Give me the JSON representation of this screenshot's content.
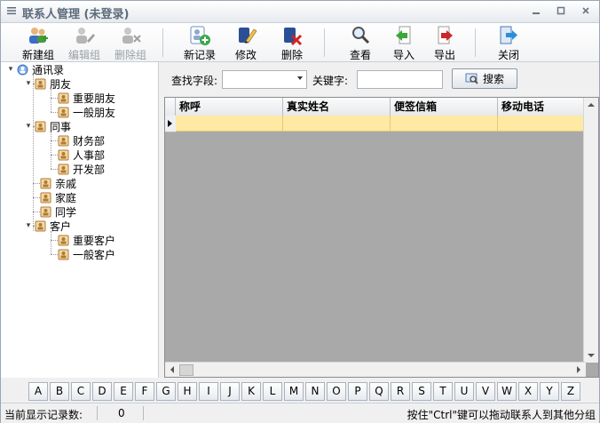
{
  "window": {
    "title": "联系人管理 (未登录)",
    "controls": [
      "minimize",
      "restore",
      "close"
    ]
  },
  "toolbar": {
    "buttons": [
      {
        "label": "新建组",
        "icon": "users-add-icon",
        "enabled": true
      },
      {
        "label": "编辑组",
        "icon": "users-edit-icon",
        "enabled": false
      },
      {
        "label": "删除组",
        "icon": "users-delete-icon",
        "enabled": false
      },
      {
        "label": "新记录",
        "icon": "contact-add-icon",
        "enabled": true
      },
      {
        "label": "修改",
        "icon": "pencil-icon",
        "enabled": true
      },
      {
        "label": "删除",
        "icon": "delete-icon",
        "enabled": true
      },
      {
        "label": "查看",
        "icon": "magnifier-icon",
        "enabled": true
      },
      {
        "label": "导入",
        "icon": "import-icon",
        "enabled": true
      },
      {
        "label": "导出",
        "icon": "export-icon",
        "enabled": true
      },
      {
        "label": "关闭",
        "icon": "exit-icon",
        "enabled": true
      }
    ]
  },
  "tree": {
    "root": "通讯录",
    "groups": [
      {
        "label": "朋友",
        "expanded": true,
        "children": [
          "重要朋友",
          "一般朋友"
        ]
      },
      {
        "label": "同事",
        "expanded": true,
        "children": [
          "财务部",
          "人事部",
          "开发部"
        ]
      },
      {
        "label": "亲戚",
        "expanded": false,
        "children": []
      },
      {
        "label": "家庭",
        "expanded": false,
        "children": []
      },
      {
        "label": "同学",
        "expanded": false,
        "children": []
      },
      {
        "label": "客户",
        "expanded": true,
        "children": [
          "重要客户",
          "一般客户"
        ]
      }
    ]
  },
  "search": {
    "field_label": "查找字段:",
    "field_value": "",
    "keyword_label": "关键字:",
    "keyword_value": "",
    "button_label": "搜索"
  },
  "grid": {
    "columns": [
      "称呼",
      "真实姓名",
      "便签信箱",
      "移动电话"
    ],
    "rows": [
      [
        "",
        "",
        "",
        ""
      ]
    ]
  },
  "alphabet": [
    "A",
    "B",
    "C",
    "D",
    "E",
    "F",
    "G",
    "H",
    "I",
    "J",
    "K",
    "L",
    "M",
    "N",
    "O",
    "P",
    "Q",
    "R",
    "S",
    "T",
    "U",
    "V",
    "W",
    "X",
    "Y",
    "Z"
  ],
  "status": {
    "count_label": "当前显示记录数:",
    "count_value": "0",
    "hint": "按住\"Ctrl\"键可以拖动联系人到其他分组"
  },
  "colors": {
    "selected_row": "#ffe9a3",
    "title_text": "#5c6b7a",
    "window_bg": "#f0f0f0"
  }
}
